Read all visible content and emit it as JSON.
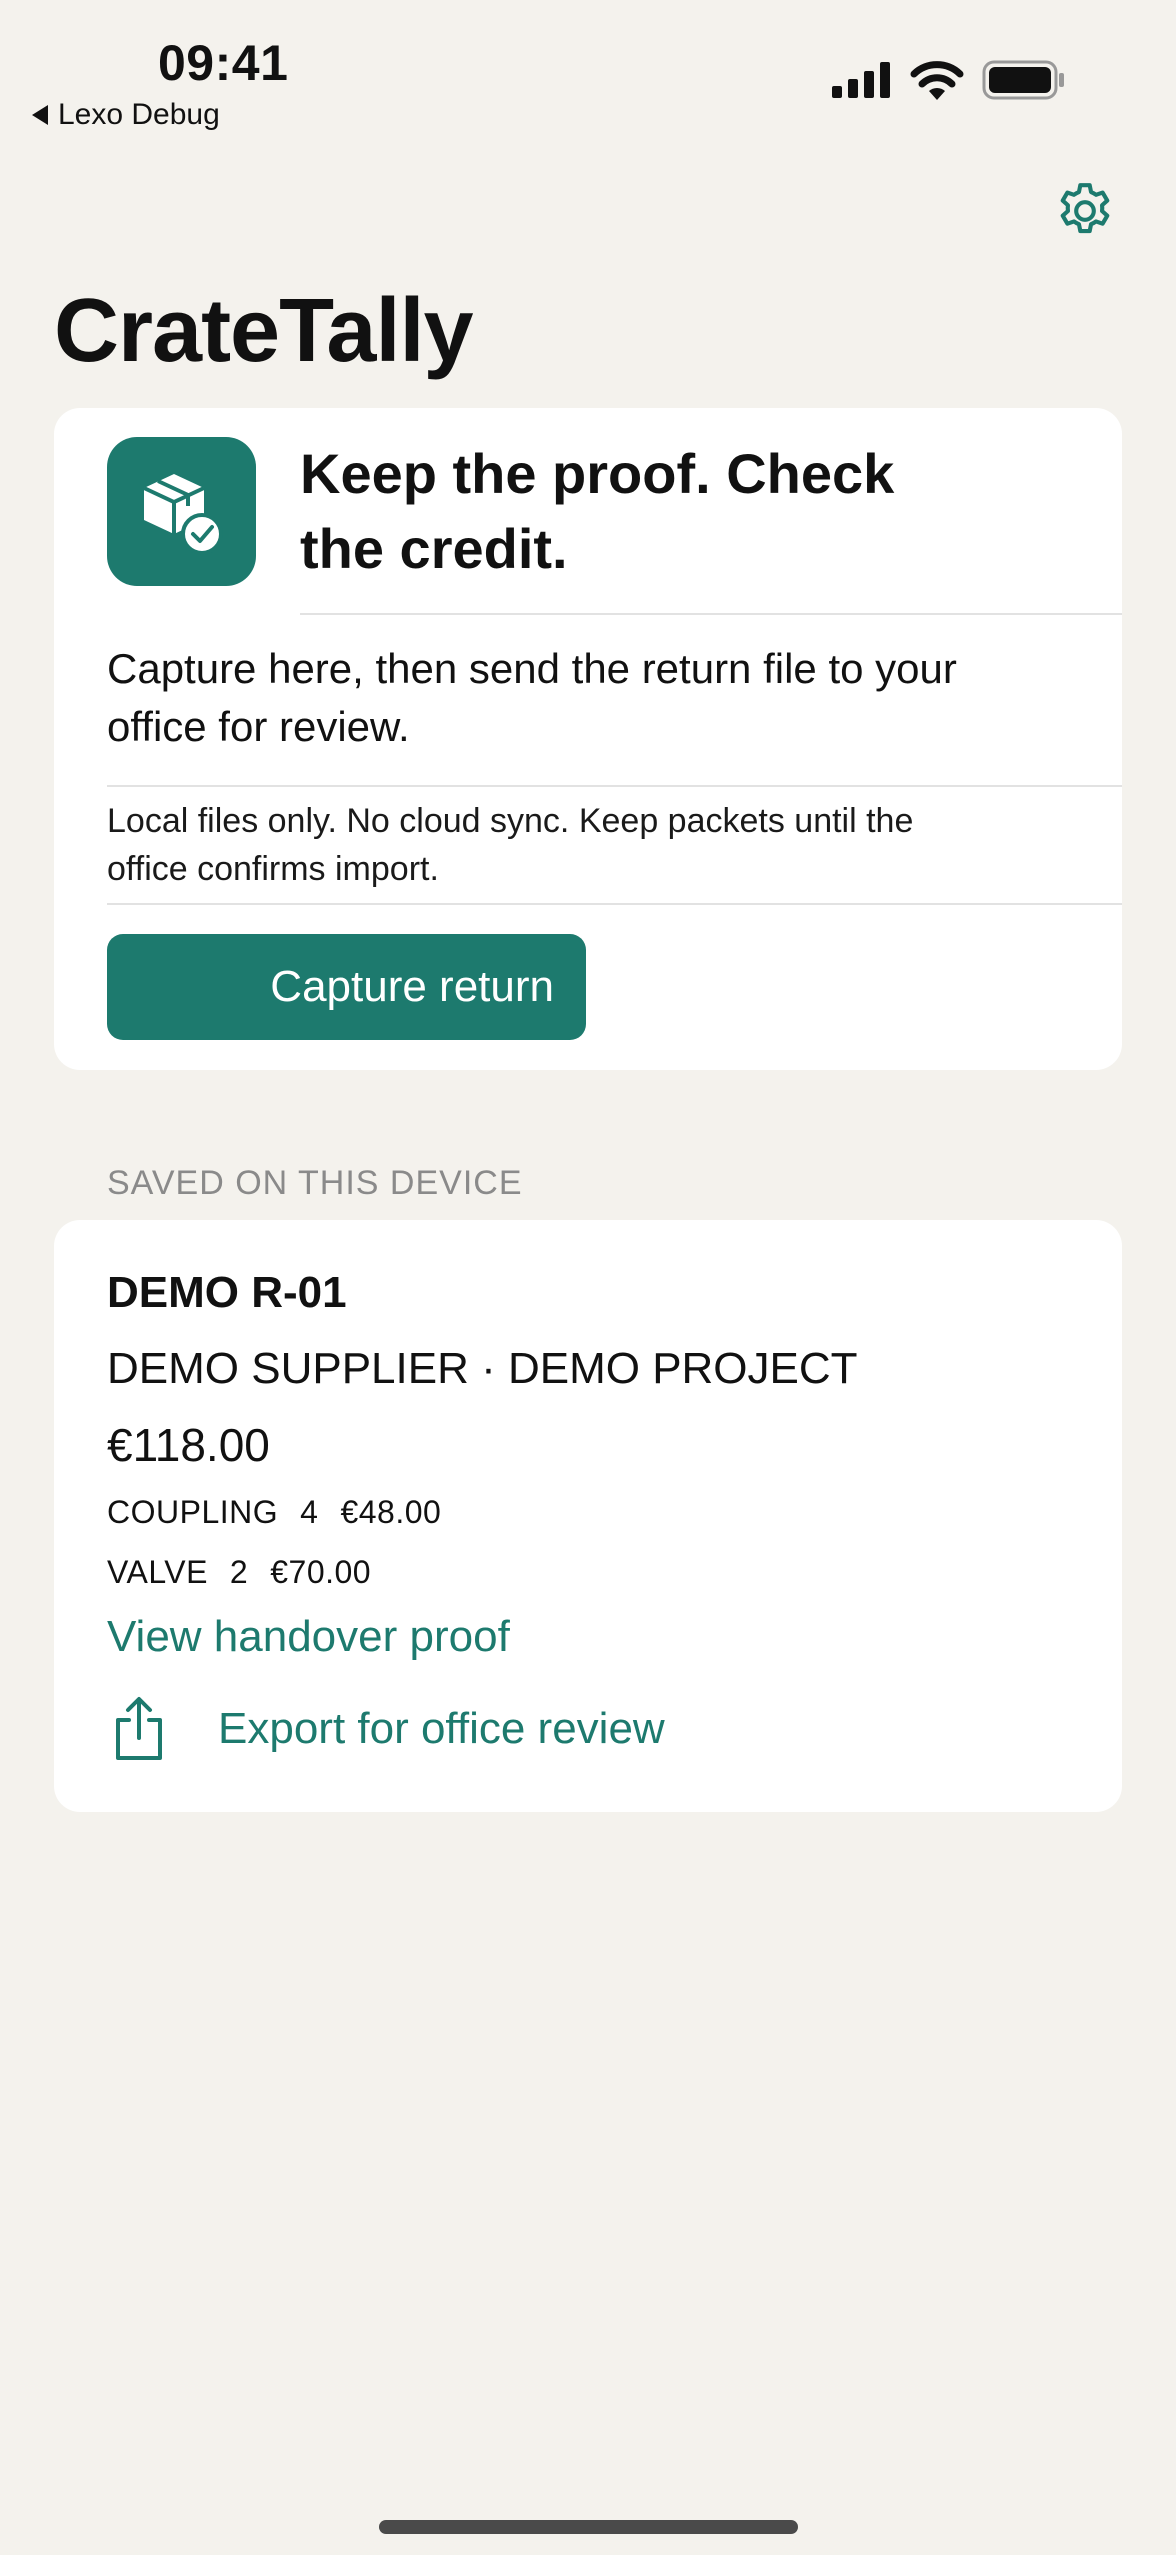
{
  "status_bar": {
    "time": "09:41",
    "back_app": "Lexo Debug",
    "icons": [
      "cellular-signal-icon",
      "wifi-icon",
      "battery-icon"
    ]
  },
  "header": {
    "settings_icon": "gear-icon",
    "title": "CrateTally"
  },
  "hero": {
    "icon": "package-check-icon",
    "headline_line1": "Keep the proof. Check",
    "headline_line2": "the credit.",
    "lead_line1": "Capture here, then send the return file to your",
    "lead_line2": "office for review.",
    "note_line1": "Local files only. No cloud sync. Keep packets until the",
    "note_line2": "office confirms import.",
    "capture_label": "Capture return"
  },
  "saved": {
    "section_label": "SAVED ON THIS DEVICE",
    "record": {
      "id": "DEMO R-01",
      "subtitle": "DEMO SUPPLIER · DEMO PROJECT",
      "total": "€118.00",
      "lines": [
        {
          "item": "COUPLING",
          "qty": "4",
          "amount": "€48.00"
        },
        {
          "item": "VALVE",
          "qty": "2",
          "amount": "€70.00"
        }
      ],
      "view_proof_label": "View handover proof",
      "export_label": "Export for office review",
      "export_icon": "share-icon"
    }
  },
  "colors": {
    "accent": "#1d7a6e",
    "background": "#f4f2ed",
    "card": "#ffffff",
    "muted": "#8a8a8a"
  }
}
